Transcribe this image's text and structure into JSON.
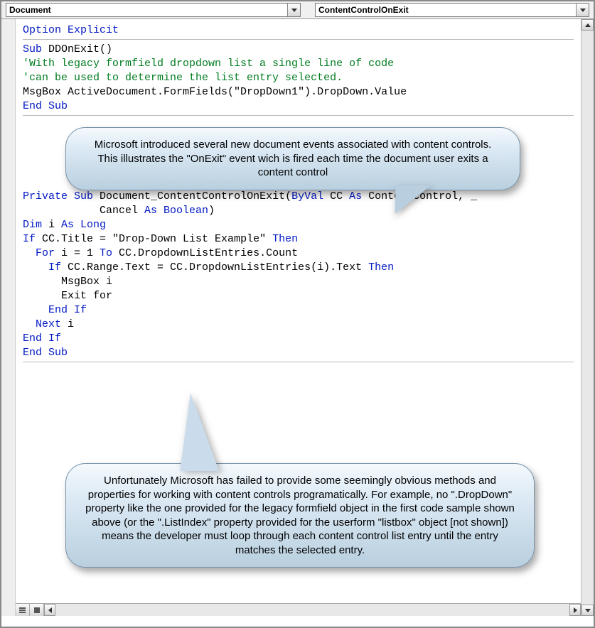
{
  "dropdowns": {
    "object": "Document",
    "procedure": "ContentControlOnExit"
  },
  "code": {
    "l1": "Option Explicit",
    "l2a": "Sub",
    "l2b": " DDOnExit()",
    "l3": "'With legacy formfield dropdown list a single line of code",
    "l4": "'can be used to determine the list entry selected.",
    "l5": "MsgBox ActiveDocument.FormFields(\"DropDown1\").DropDown.Value",
    "l6": "End Sub",
    "l7a": "Private Sub",
    "l7b": " Document_ContentControlOnExit(",
    "l7c": "ByVal",
    "l7d": " CC ",
    "l7e": "As",
    "l7f": " ContentControl, _",
    "l8a": "            Cancel ",
    "l8b": "As Boolean",
    "l8c": ")",
    "l9a": "Dim",
    "l9b": " i ",
    "l9c": "As Long",
    "l10a": "If",
    "l10b": " CC.Title = \"Drop-Down List Example\" ",
    "l10c": "Then",
    "l11a": "  For",
    "l11b": " i = 1 ",
    "l11c": "To",
    "l11d": " CC.DropdownListEntries.Count",
    "l12a": "    If",
    "l12b": " CC.Range.Text = CC.DropdownListEntries(i).Text ",
    "l12c": "Then",
    "l13": "      MsgBox i",
    "l14": "      Exit for",
    "l15": "    End If",
    "l16a": "  Next",
    "l16b": " i",
    "l17": "End If",
    "l18": "End Sub"
  },
  "callouts": {
    "c1": "Microsoft introduced several new document events associated with content controls.  This illustrates the \"OnExit\" event wich is fired each time the document user exits a content control",
    "c2": "Unfortunately Microsoft has failed to provide some seemingly obvious methods and properties for working with content controls programatically.  For example, no \".DropDown\" property like the one provided for the legacy formfield object in the first code sample shown above (or the \".ListIndex\" property provided for the userform \"listbox\" object [not shown]) means the developer must loop through each content control list entry until the entry matches the selected entry."
  }
}
